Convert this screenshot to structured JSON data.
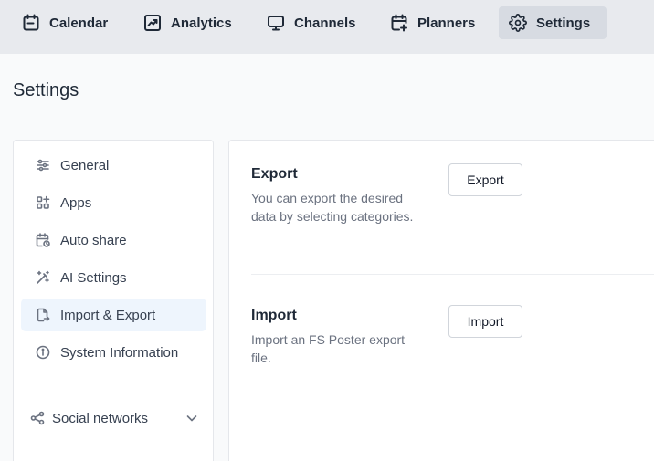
{
  "nav": {
    "items": [
      {
        "label": "Calendar",
        "icon": "calendar-icon",
        "active": false
      },
      {
        "label": "Analytics",
        "icon": "analytics-icon",
        "active": false
      },
      {
        "label": "Channels",
        "icon": "monitor-icon",
        "active": false
      },
      {
        "label": "Planners",
        "icon": "calendar-plus-icon",
        "active": false
      },
      {
        "label": "Settings",
        "icon": "gear-icon",
        "active": true
      }
    ]
  },
  "page": {
    "title": "Settings"
  },
  "sidebar": {
    "items": [
      {
        "label": "General",
        "icon": "sliders-icon",
        "active": false
      },
      {
        "label": "Apps",
        "icon": "apps-icon",
        "active": false
      },
      {
        "label": "Auto share",
        "icon": "calendar-clock-icon",
        "active": false
      },
      {
        "label": "AI Settings",
        "icon": "magic-wand-icon",
        "active": false
      },
      {
        "label": "Import & Export",
        "icon": "file-export-icon",
        "active": true
      },
      {
        "label": "System Information",
        "icon": "info-icon",
        "active": false
      }
    ],
    "group": {
      "label": "Social networks",
      "icon": "share-icon",
      "expanded": false
    }
  },
  "main": {
    "export": {
      "title": "Export",
      "description": "You can export the desired data by selecting categories.",
      "button_label": "Export"
    },
    "import": {
      "title": "Import",
      "description": "Import an FS Poster export file.",
      "button_label": "Import"
    }
  },
  "colors": {
    "nav_background": "#e8eaee",
    "nav_active": "#d7dbe2",
    "sidebar_active": "#eef5fd",
    "text_primary": "#1f2937",
    "text_muted": "#6b7280"
  }
}
